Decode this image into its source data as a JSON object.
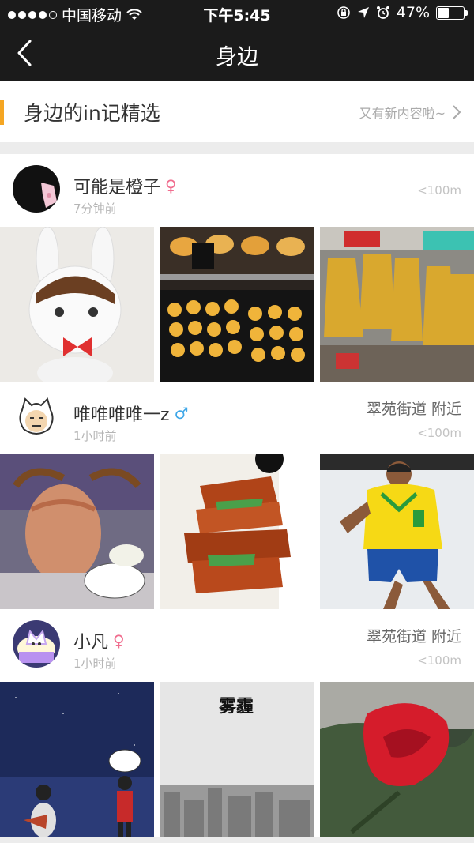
{
  "status_bar": {
    "carrier": "中国移动",
    "time": "下午5:45",
    "battery": "47%",
    "battery_level": 0.47
  },
  "nav": {
    "title": "身边"
  },
  "banner": {
    "title": "身边的in记精选",
    "more_label": "又有新内容啦~"
  },
  "posts": [
    {
      "username": "可能是橙子",
      "gender": "female",
      "time_ago": "7分钟前",
      "location": "",
      "distance": "<100m"
    },
    {
      "username": "唯唯唯唯一z",
      "gender": "male",
      "time_ago": "1小时前",
      "location": "翠苑街道 附近",
      "distance": "<100m"
    },
    {
      "username": "小凡",
      "gender": "female",
      "time_ago": "1小时前",
      "location": "翠苑街道 附近",
      "distance": "<100m"
    }
  ],
  "photo_text": {
    "haze_title": "雾霾"
  },
  "colors": {
    "accent": "#f5a623",
    "bar_bg": "#1b1b1b",
    "female": "#f06d8e",
    "male": "#3fa7e8"
  }
}
